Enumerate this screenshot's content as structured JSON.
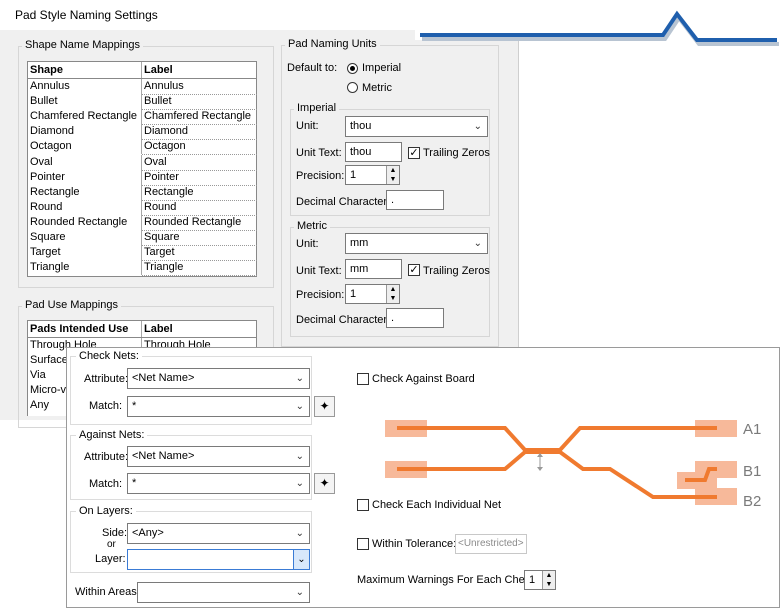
{
  "pad_dialog": {
    "title": "Pad Style Naming Settings",
    "shape_mappings": {
      "group_label": "Shape Name Mappings",
      "columns": [
        "Shape",
        "Label"
      ],
      "rows": [
        [
          "Annulus",
          "Annulus"
        ],
        [
          "Bullet",
          "Bullet"
        ],
        [
          "Chamfered Rectangle",
          "Chamfered Rectangle"
        ],
        [
          "Diamond",
          "Diamond"
        ],
        [
          "Octagon",
          "Octagon"
        ],
        [
          "Oval",
          "Oval"
        ],
        [
          "Pointer",
          "Pointer"
        ],
        [
          "Rectangle",
          "Rectangle"
        ],
        [
          "Round",
          "Round"
        ],
        [
          "Rounded Rectangle",
          "Rounded Rectangle"
        ],
        [
          "Square",
          "Square"
        ],
        [
          "Target",
          "Target"
        ],
        [
          "Triangle",
          "Triangle"
        ]
      ]
    },
    "use_mappings": {
      "group_label": "Pad Use Mappings",
      "columns": [
        "Pads Intended Use",
        "Label"
      ],
      "rows": [
        [
          "Through Hole",
          "Through Hole"
        ],
        [
          "Surface",
          ""
        ],
        [
          "Via",
          ""
        ],
        [
          "Micro-v",
          ""
        ],
        [
          "Any",
          ""
        ]
      ]
    },
    "units": {
      "group_label": "Pad Naming Units",
      "default_label": "Default to:",
      "option_imperial": "Imperial",
      "option_metric": "Metric",
      "selected": "Imperial",
      "imperial": {
        "group_label": "Imperial",
        "unit_label": "Unit:",
        "unit_value": "thou",
        "unit_text_label": "Unit Text:",
        "unit_text_value": "thou",
        "trailing_zeros_label": "Trailing Zeros",
        "trailing_zeros_checked": true,
        "precision_label": "Precision:",
        "precision_value": "1",
        "decimal_label": "Decimal Character:",
        "decimal_value": "."
      },
      "metric": {
        "group_label": "Metric",
        "unit_label": "Unit:",
        "unit_value": "mm",
        "unit_text_label": "Unit Text:",
        "unit_text_value": "mm",
        "trailing_zeros_label": "Trailing Zeros",
        "trailing_zeros_checked": true,
        "precision_label": "Precision:",
        "precision_value": "1",
        "decimal_label": "Decimal Character:",
        "decimal_value": "."
      }
    }
  },
  "check_dialog": {
    "check_nets": {
      "group_label": "Check Nets:",
      "attribute_label": "Attribute:",
      "attribute_value": "<Net Name>",
      "match_label": "Match:",
      "match_value": "*"
    },
    "against_nets": {
      "group_label": "Against Nets:",
      "attribute_label": "Attribute:",
      "attribute_value": "<Net Name>",
      "match_label": "Match:",
      "match_value": "*"
    },
    "on_layers": {
      "group_label": "On Layers:",
      "side_label": "Side:",
      "side_value": "<Any>",
      "or_label": "or",
      "layer_label": "Layer:",
      "layer_value": ""
    },
    "within_areas_label": "Within Areas:",
    "within_areas_value": "",
    "check_against_board": "Check Against Board",
    "check_each_individual_net": "Check Each Individual Net",
    "within_tolerance": "Within Tolerance:",
    "tolerance_value": "<Unrestricted>",
    "max_warnings_label": "Maximum Warnings For Each Check:",
    "max_warnings_value": "1",
    "diagram_labels": [
      "A1",
      "B1",
      "B2"
    ],
    "trace_color": "#f07a2f",
    "pad_color": "#f7b99a"
  },
  "accent_color": "#1f5fad"
}
